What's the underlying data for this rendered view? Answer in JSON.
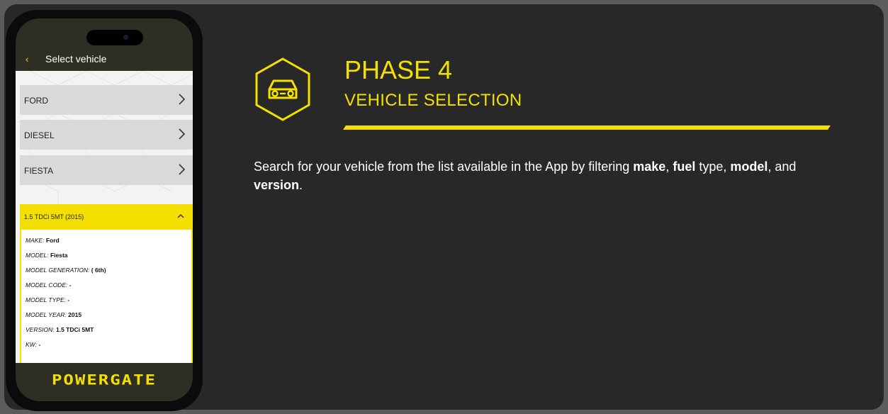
{
  "app": {
    "header_title": "Select vehicle",
    "back_icon": "chevron-left-icon",
    "list": [
      {
        "label": "FORD"
      },
      {
        "label": "DIESEL"
      },
      {
        "label": "FIESTA"
      }
    ],
    "expanded": {
      "label": "1.5 TDCi 5MT (2015)",
      "rows": [
        {
          "key": "MAKE:",
          "value": "Ford"
        },
        {
          "key": "MODEL:",
          "value": "Fiesta"
        },
        {
          "key": "MODEL GENERATION:",
          "value": "( 6th)"
        },
        {
          "key": "MODEL CODE:",
          "value": "-"
        },
        {
          "key": "MODEL TYPE:",
          "value": "-"
        },
        {
          "key": "MODEL YEAR:",
          "value": "2015"
        },
        {
          "key": "VERSION:",
          "value": "1.5 TDCi 5MT"
        },
        {
          "key": "KW:",
          "value": "-"
        }
      ]
    },
    "logo_text": "POWERGATE"
  },
  "main": {
    "phase_title": "PHASE 4",
    "phase_subtitle": "VEHICLE SELECTION",
    "icon": "car-icon",
    "description": {
      "t1": "Search for your vehicle from the list available in the App by filtering ",
      "b1": "make",
      "t2": ", ",
      "b2": "fuel",
      "t3": " type, ",
      "b3": "model",
      "t4": ", and ",
      "b4": "version",
      "t5": "."
    }
  },
  "colors": {
    "accent": "#f4e000",
    "panel": "#282828",
    "page": "#5c5c5c"
  }
}
